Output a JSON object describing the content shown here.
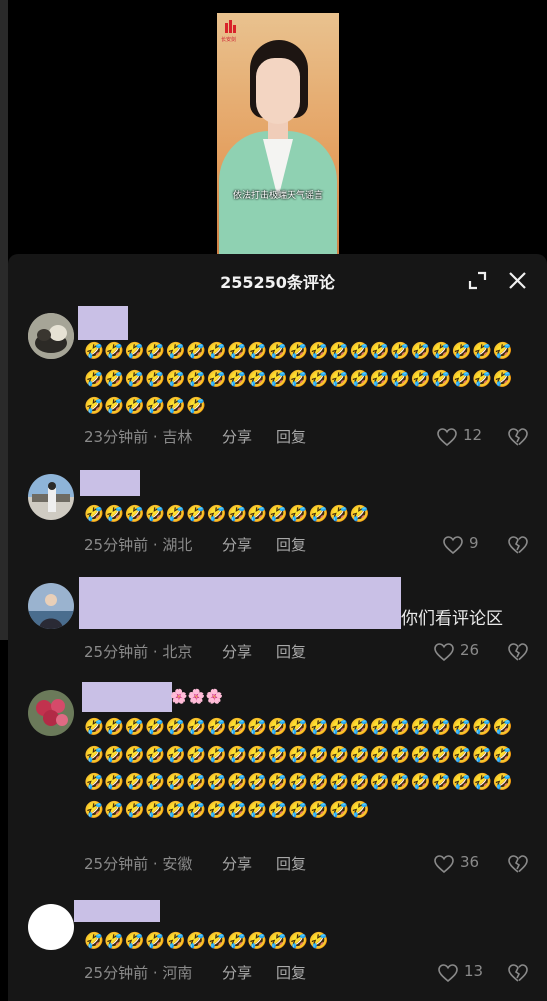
{
  "video": {
    "logo_text": "长安剑",
    "subtitle": "依法打击极端天气谣言"
  },
  "sheet": {
    "title": "255250条评论"
  },
  "icons": {
    "emoji": "😂",
    "flower": "🌸"
  },
  "comments": [
    {
      "text": "🤣🤣🤣🤣🤣🤣🤣🤣🤣🤣🤣🤣🤣🤣🤣🤣🤣🤣🤣🤣🤣🤣🤣🤣🤣🤣🤣🤣🤣🤣🤣🤣🤣🤣🤣🤣🤣🤣🤣🤣🤣🤣🤣🤣🤣🤣🤣🤣",
      "time": "23分钟前 · 吉林",
      "share": "分享",
      "reply": "回复",
      "likes": "12"
    },
    {
      "text": "🤣🤣🤣🤣🤣🤣🤣🤣🤣🤣🤣🤣🤣🤣",
      "time": "25分钟前 · 湖北",
      "share": "分享",
      "reply": "回复",
      "likes": "9"
    },
    {
      "text": "你们看评论区",
      "time": "25分钟前 · 北京",
      "share": "分享",
      "reply": "回复",
      "likes": "26"
    },
    {
      "text": "🤣🤣🤣🤣🤣🤣🤣🤣🤣🤣🤣🤣🤣🤣🤣🤣🤣🤣🤣🤣🤣🤣🤣🤣🤣🤣🤣🤣🤣🤣🤣🤣🤣🤣🤣🤣🤣🤣🤣🤣🤣🤣🤣🤣🤣🤣🤣🤣🤣🤣🤣🤣🤣🤣🤣🤣🤣🤣🤣🤣🤣🤣🤣🤣🤣🤣🤣🤣🤣🤣🤣🤣🤣🤣🤣🤣🤣",
      "name_suffix": "🌸🌸🌸",
      "time": "25分钟前 · 安徽",
      "share": "分享",
      "reply": "回复",
      "likes": "36"
    },
    {
      "text": "🤣🤣🤣🤣🤣🤣🤣🤣🤣🤣🤣🤣",
      "time": "25分钟前 · 河南",
      "share": "分享",
      "reply": "回复",
      "likes": "13"
    }
  ]
}
